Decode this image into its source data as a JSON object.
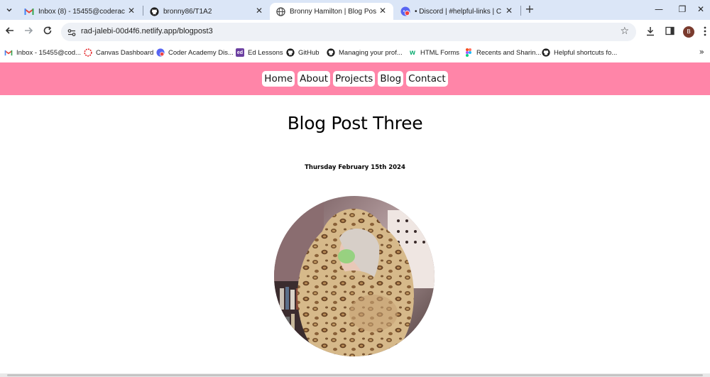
{
  "browser": {
    "tabs": [
      {
        "title": "Inbox (8) - 15455@coderacade",
        "icon": "gmail-icon",
        "active": false
      },
      {
        "title": "bronny86/T1A2",
        "icon": "github-icon",
        "active": false
      },
      {
        "title": "Bronny Hamilton | Blog Post",
        "icon": "globe-icon",
        "active": true
      },
      {
        "title": "• Discord | #helpful-links | Code",
        "icon": "discord-icon",
        "active": false
      }
    ],
    "new_tab_label": "+",
    "window_controls": {
      "minimize": "—",
      "restore": "❐",
      "close": "✕"
    },
    "url": "rad-jalebi-00d4f6.netlify.app/blogpost3",
    "profile_initial": "B",
    "bookmarks": [
      {
        "label": "Inbox - 15455@cod...",
        "icon": "gmail-icon"
      },
      {
        "label": "Canvas Dashboard",
        "icon": "canvas-icon"
      },
      {
        "label": "Coder Academy Dis...",
        "icon": "discord-icon"
      },
      {
        "label": "Ed Lessons",
        "icon": "ed-icon"
      },
      {
        "label": "GitHub",
        "icon": "github-icon"
      },
      {
        "label": "Managing your prof...",
        "icon": "github-icon"
      },
      {
        "label": "HTML Forms",
        "icon": "w3schools-icon"
      },
      {
        "label": "Recents and Sharin...",
        "icon": "figma-icon"
      },
      {
        "label": "Helpful shortcuts fo...",
        "icon": "github-icon"
      }
    ],
    "bookmarks_overflow": "»"
  },
  "site": {
    "nav": [
      "Home",
      "About",
      "Projects",
      "Blog",
      "Contact"
    ],
    "post_title": "Blog Post Three",
    "post_date": "Thursday February 15th 2024"
  },
  "colors": {
    "nav_bg": "#ff85a8",
    "tabstrip_bg": "#dbe6f7"
  }
}
